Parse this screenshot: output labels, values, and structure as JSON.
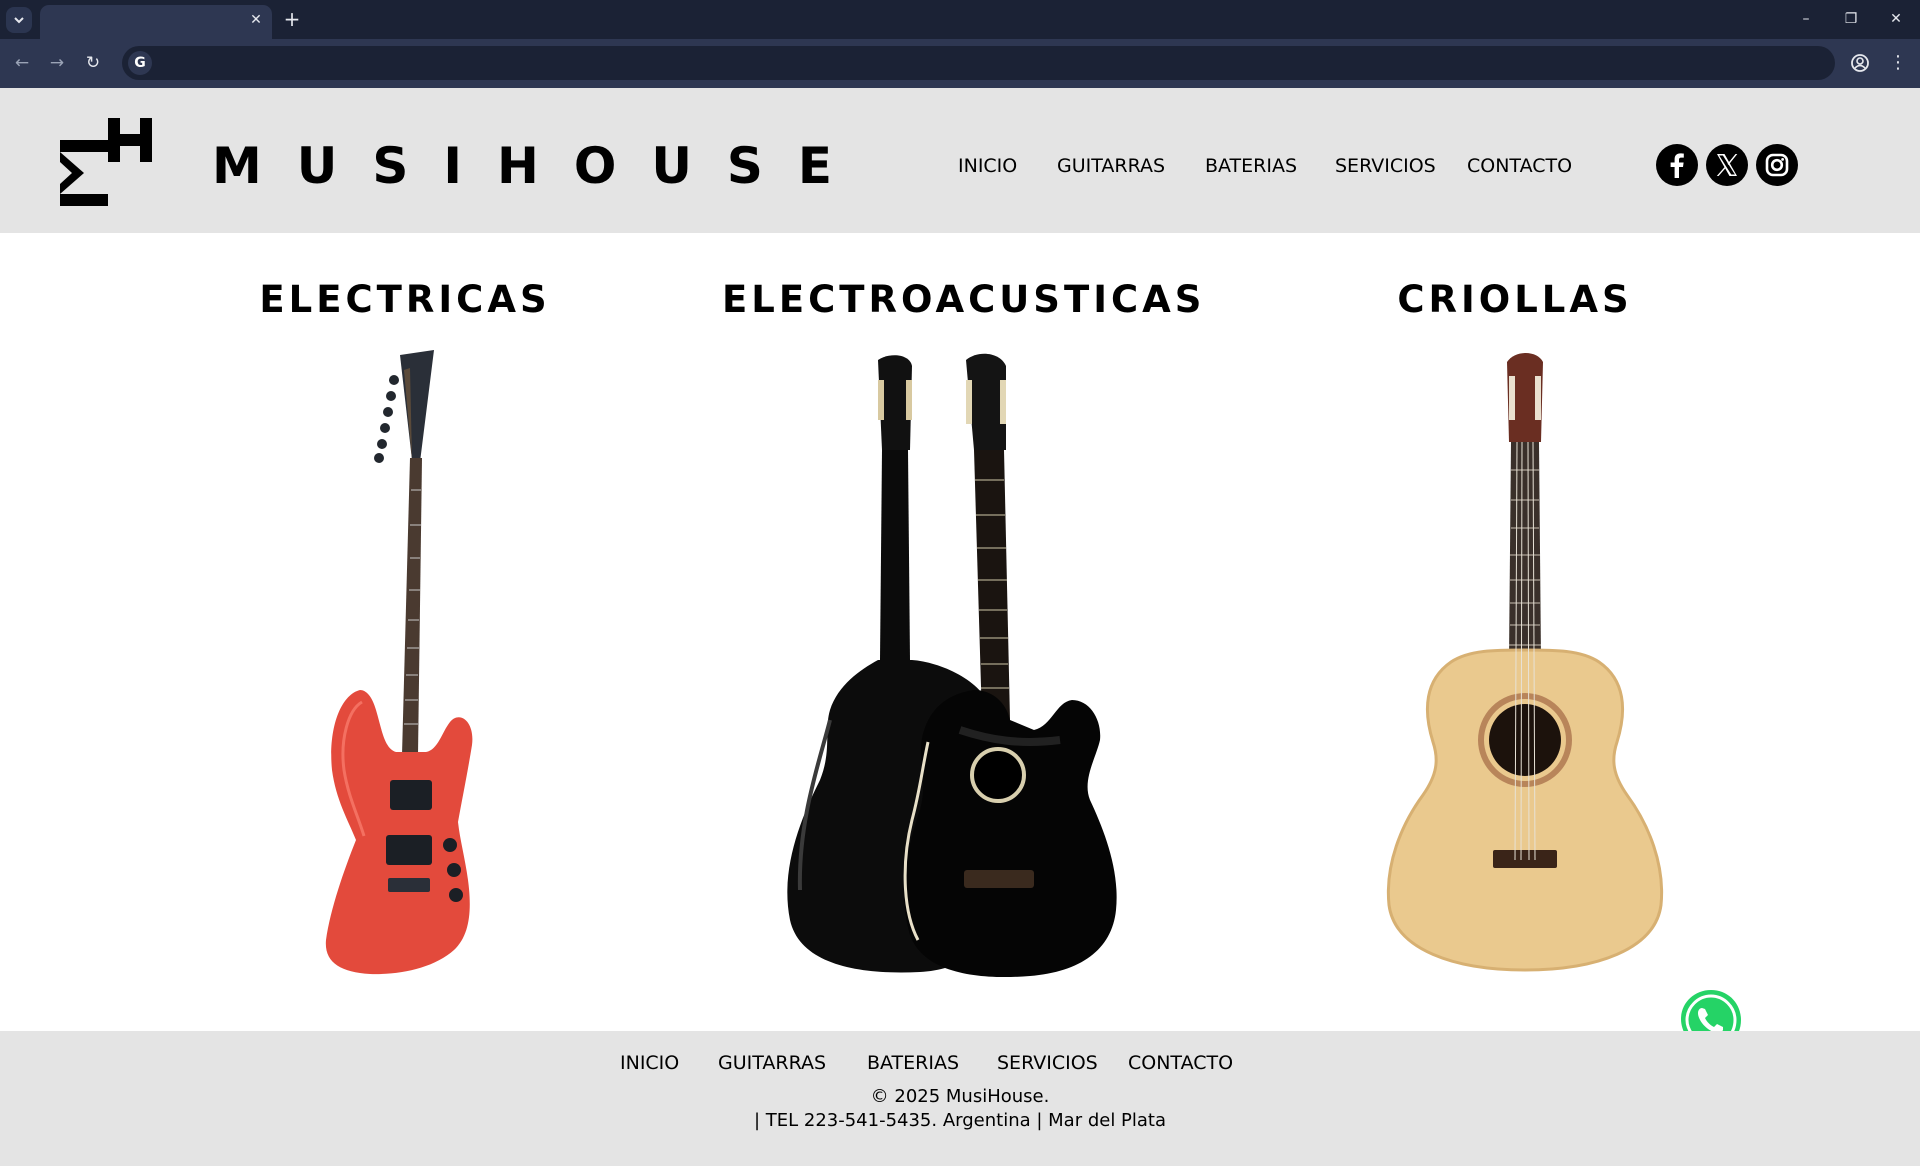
{
  "browser": {
    "tab_close": "✕",
    "new_tab": "+",
    "omnibox_icon": "G",
    "window_controls": {
      "minimize": "–",
      "maximize": "❐",
      "close": "✕"
    },
    "nav": {
      "back": "←",
      "forward": "→",
      "reload": "↻"
    },
    "icons": [
      "tab-search-icon",
      "google-icon",
      "bookmark-star-icon",
      "profile-icon",
      "menu-kebab-icon"
    ]
  },
  "header": {
    "brand": "MUSIHOUSE",
    "logo_letters": [
      "M",
      "H"
    ],
    "nav": [
      "INICIO",
      "GUITARRAS",
      "BATERIAS",
      "SERVICIOS",
      "CONTACTO"
    ],
    "social": [
      "facebook-icon",
      "x-twitter-icon",
      "instagram-icon"
    ]
  },
  "categories": [
    {
      "title": "ELECTRICAS",
      "image": "electric-guitar-red"
    },
    {
      "title": "ELECTROACUSTICAS",
      "image": "electro-acoustic-guitars-black"
    },
    {
      "title": "CRIOLLAS",
      "image": "classical-guitar-natural"
    }
  ],
  "footer": {
    "nav": [
      "INICIO",
      "GUITARRAS",
      "BATERIAS",
      "SERVICIOS",
      "CONTACTO"
    ],
    "copyright": "© 2025 MusiHouse.",
    "contact": "| TEL 223-541-5435.  Argentina | Mar del Plata"
  },
  "colors": {
    "chrome_dark": "#1b2235",
    "chrome_toolbar": "#2e3752",
    "header_bg": "#e4e4e4",
    "whatsapp_green": "#25d366"
  },
  "floating": {
    "whatsapp": "whatsapp-icon"
  }
}
